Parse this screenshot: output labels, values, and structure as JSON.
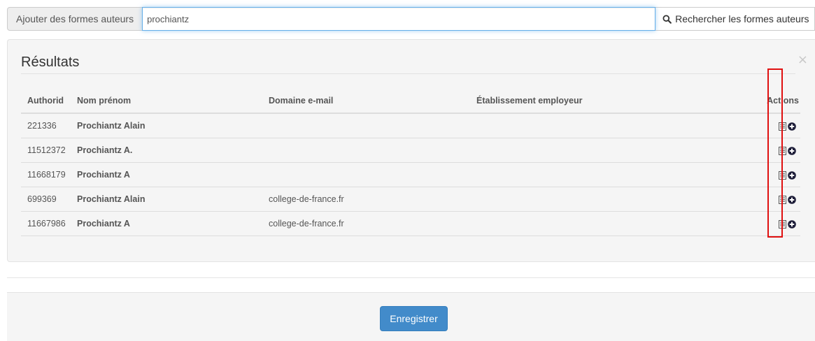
{
  "search": {
    "addon_label": "Ajouter des formes auteurs",
    "query": "prochiantz",
    "button_label": "Rechercher les formes auteurs",
    "button_icon": "search-icon"
  },
  "results": {
    "title": "Résultats",
    "close_symbol": "×",
    "columns": {
      "authorid": "Authorid",
      "name": "Nom prénom",
      "domain": "Domaine e-mail",
      "institution": "Établissement employeur",
      "actions": "Actions"
    },
    "rows": [
      {
        "authorid": "221336",
        "name": "Prochiantz Alain",
        "domain": "",
        "institution": ""
      },
      {
        "authorid": "11512372",
        "name": "Prochiantz A.",
        "domain": "",
        "institution": ""
      },
      {
        "authorid": "11668179",
        "name": "Prochiantz A",
        "domain": "",
        "institution": ""
      },
      {
        "authorid": "699369",
        "name": "Prochiantz Alain",
        "domain": "college-de-france.fr",
        "institution": ""
      },
      {
        "authorid": "11667986",
        "name": "Prochiantz A",
        "domain": "college-de-france.fr",
        "institution": ""
      }
    ],
    "row_action_icons": [
      "list-details-icon",
      "plus-circle-icon"
    ],
    "highlight_color": "#e01010"
  },
  "footer": {
    "save_label": "Enregistrer"
  },
  "colors": {
    "primary": "#428bca",
    "panel_bg": "#f5f5f5",
    "input_focus": "#66afe9"
  }
}
